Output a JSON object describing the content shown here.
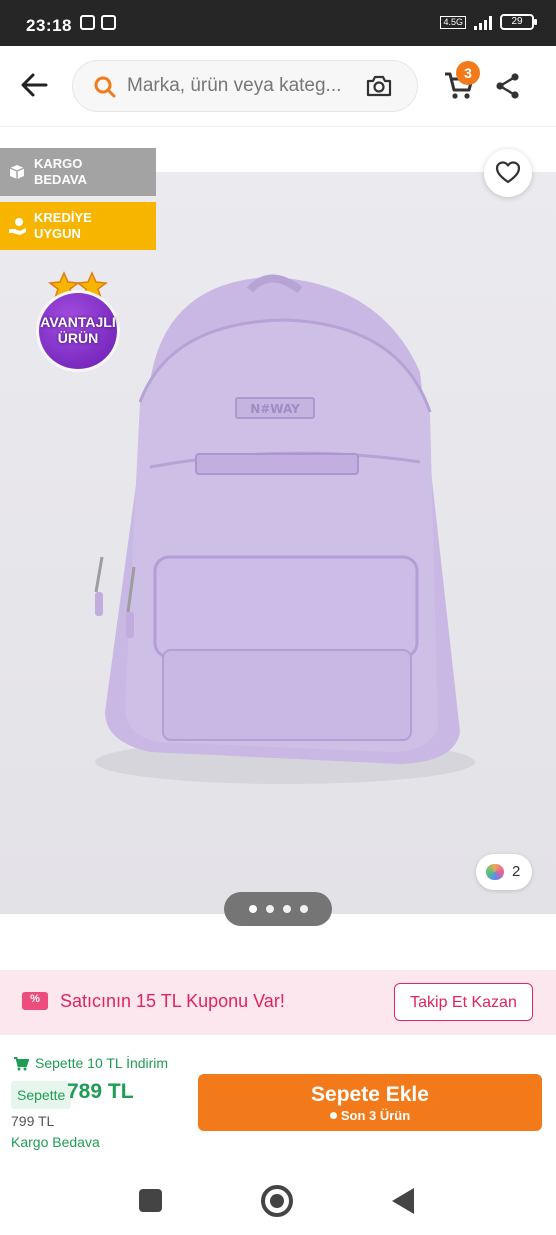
{
  "status_bar": {
    "time": "23:18",
    "network": "4.5G",
    "battery": "29"
  },
  "header": {
    "search_placeholder": "Marka, ürün veya kateg...",
    "cart_count": "3"
  },
  "product_image": {
    "tags": {
      "kargo": "KARGO\nBEDAVA",
      "kredi": "KREDİYE\nUYGUN"
    },
    "advantage_badge": "AVANTAJLI\nÜRÜN",
    "variant_count": "2",
    "pager": {
      "total": 4,
      "active": 1
    },
    "brand_patch": "N#WAY"
  },
  "coupon": {
    "icon_text": "%",
    "text": "Satıcının 15 TL Kuponu Var!",
    "button": "Takip Et Kazan"
  },
  "purchase": {
    "basket_discount": "Sepette 10 TL İndirim",
    "basket_label": "Sepette",
    "basket_price": "789 TL",
    "old_price": "799 TL",
    "shipping": "Kargo Bedava",
    "add_to_cart": "Sepete Ekle",
    "stock_note": "Son 3 Ürün"
  },
  "colors": {
    "accent_orange": "#f27a1a",
    "coupon_pink": "#e0245e",
    "green": "#1f9d55",
    "credit_yellow": "#f7b500",
    "badge_purple": "#7b23c7"
  }
}
